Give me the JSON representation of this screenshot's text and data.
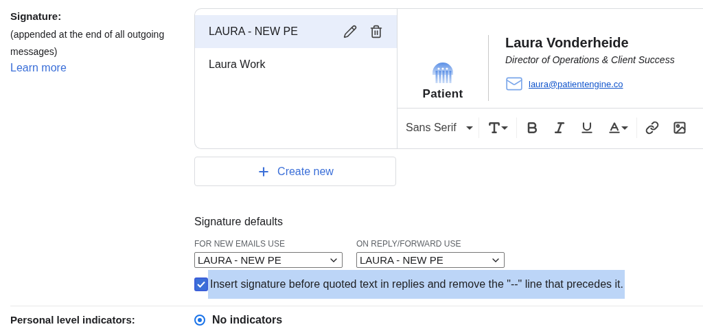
{
  "signature_section": {
    "label": "Signature:",
    "description": "(appended at the end of all outgoing messages)",
    "link": "Learn more"
  },
  "signatures": [
    {
      "name": "LAURA - NEW PE",
      "selected": true
    },
    {
      "name": "Laura Work",
      "selected": false
    }
  ],
  "preview": {
    "logo_text": "Patient",
    "name": "Laura Vonderheide",
    "title": "Director of Operations & Client Success",
    "email": "laura@patientengine.co"
  },
  "toolbar": {
    "font": "Sans Serif"
  },
  "create_button": "Create new",
  "defaults": {
    "title": "Signature defaults",
    "selects": [
      {
        "label": "FOR NEW EMAILS USE",
        "value": "LAURA - NEW PE"
      },
      {
        "label": "ON REPLY/FORWARD USE",
        "value": "LAURA - NEW PE"
      }
    ]
  },
  "insert_option": {
    "label": "Insert signature before quoted text in replies and remove the \"--\" line that precedes it.",
    "checked": true,
    "highlighted": true
  },
  "next_section": {
    "label": "Personal level indicators:",
    "option": {
      "label": "No indicators",
      "selected": true
    }
  }
}
